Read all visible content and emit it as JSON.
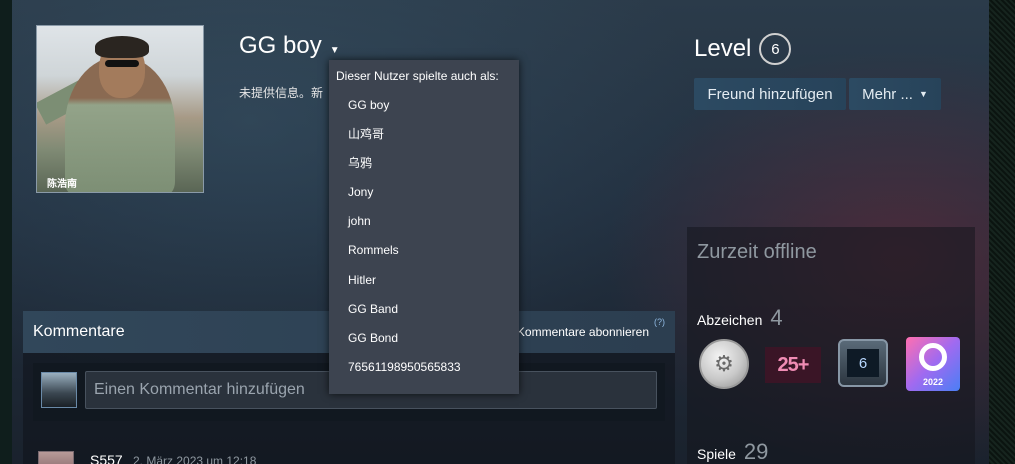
{
  "profile": {
    "name": "GG boy",
    "summary": "未提供信息。新",
    "avatar_caption": "陈浩南"
  },
  "alias_menu": {
    "heading": "Dieser Nutzer spielte auch als:",
    "aliases": [
      "GG boy",
      "山鸡哥",
      "乌鸦",
      "Jony",
      "john",
      "Rommels",
      "Hitler",
      "GG Band",
      "GG Bond",
      "76561198950565833"
    ]
  },
  "level": {
    "label": "Level",
    "value": "6"
  },
  "actions": {
    "add_friend": "Freund hinzufügen",
    "more": "Mehr ..."
  },
  "status": {
    "text": "Zurzeit offline",
    "badges_label": "Abzeichen",
    "badges_count": "4",
    "badges": [
      {
        "icon": "silver-coin-badge-icon",
        "text": ""
      },
      {
        "icon": "25-plus-badge-icon",
        "text": "25+"
      },
      {
        "icon": "level-6-screen-badge-icon",
        "text": "6"
      },
      {
        "icon": "steam-2022-badge-icon",
        "text": "2022"
      }
    ],
    "games_label": "Spiele",
    "games_count": "29"
  },
  "comments": {
    "title": "Kommentare",
    "subscribe": "Kommentare abonnieren",
    "help": "(?)",
    "input_placeholder": "Einen Kommentar hinzufügen",
    "first_comment": {
      "author": "S557",
      "time": "2. März 2023 um 12:18"
    }
  },
  "colors": {
    "accent": "#2a475e",
    "dropdown_bg": "#3d4450",
    "muted_text": "#8f98a0"
  }
}
